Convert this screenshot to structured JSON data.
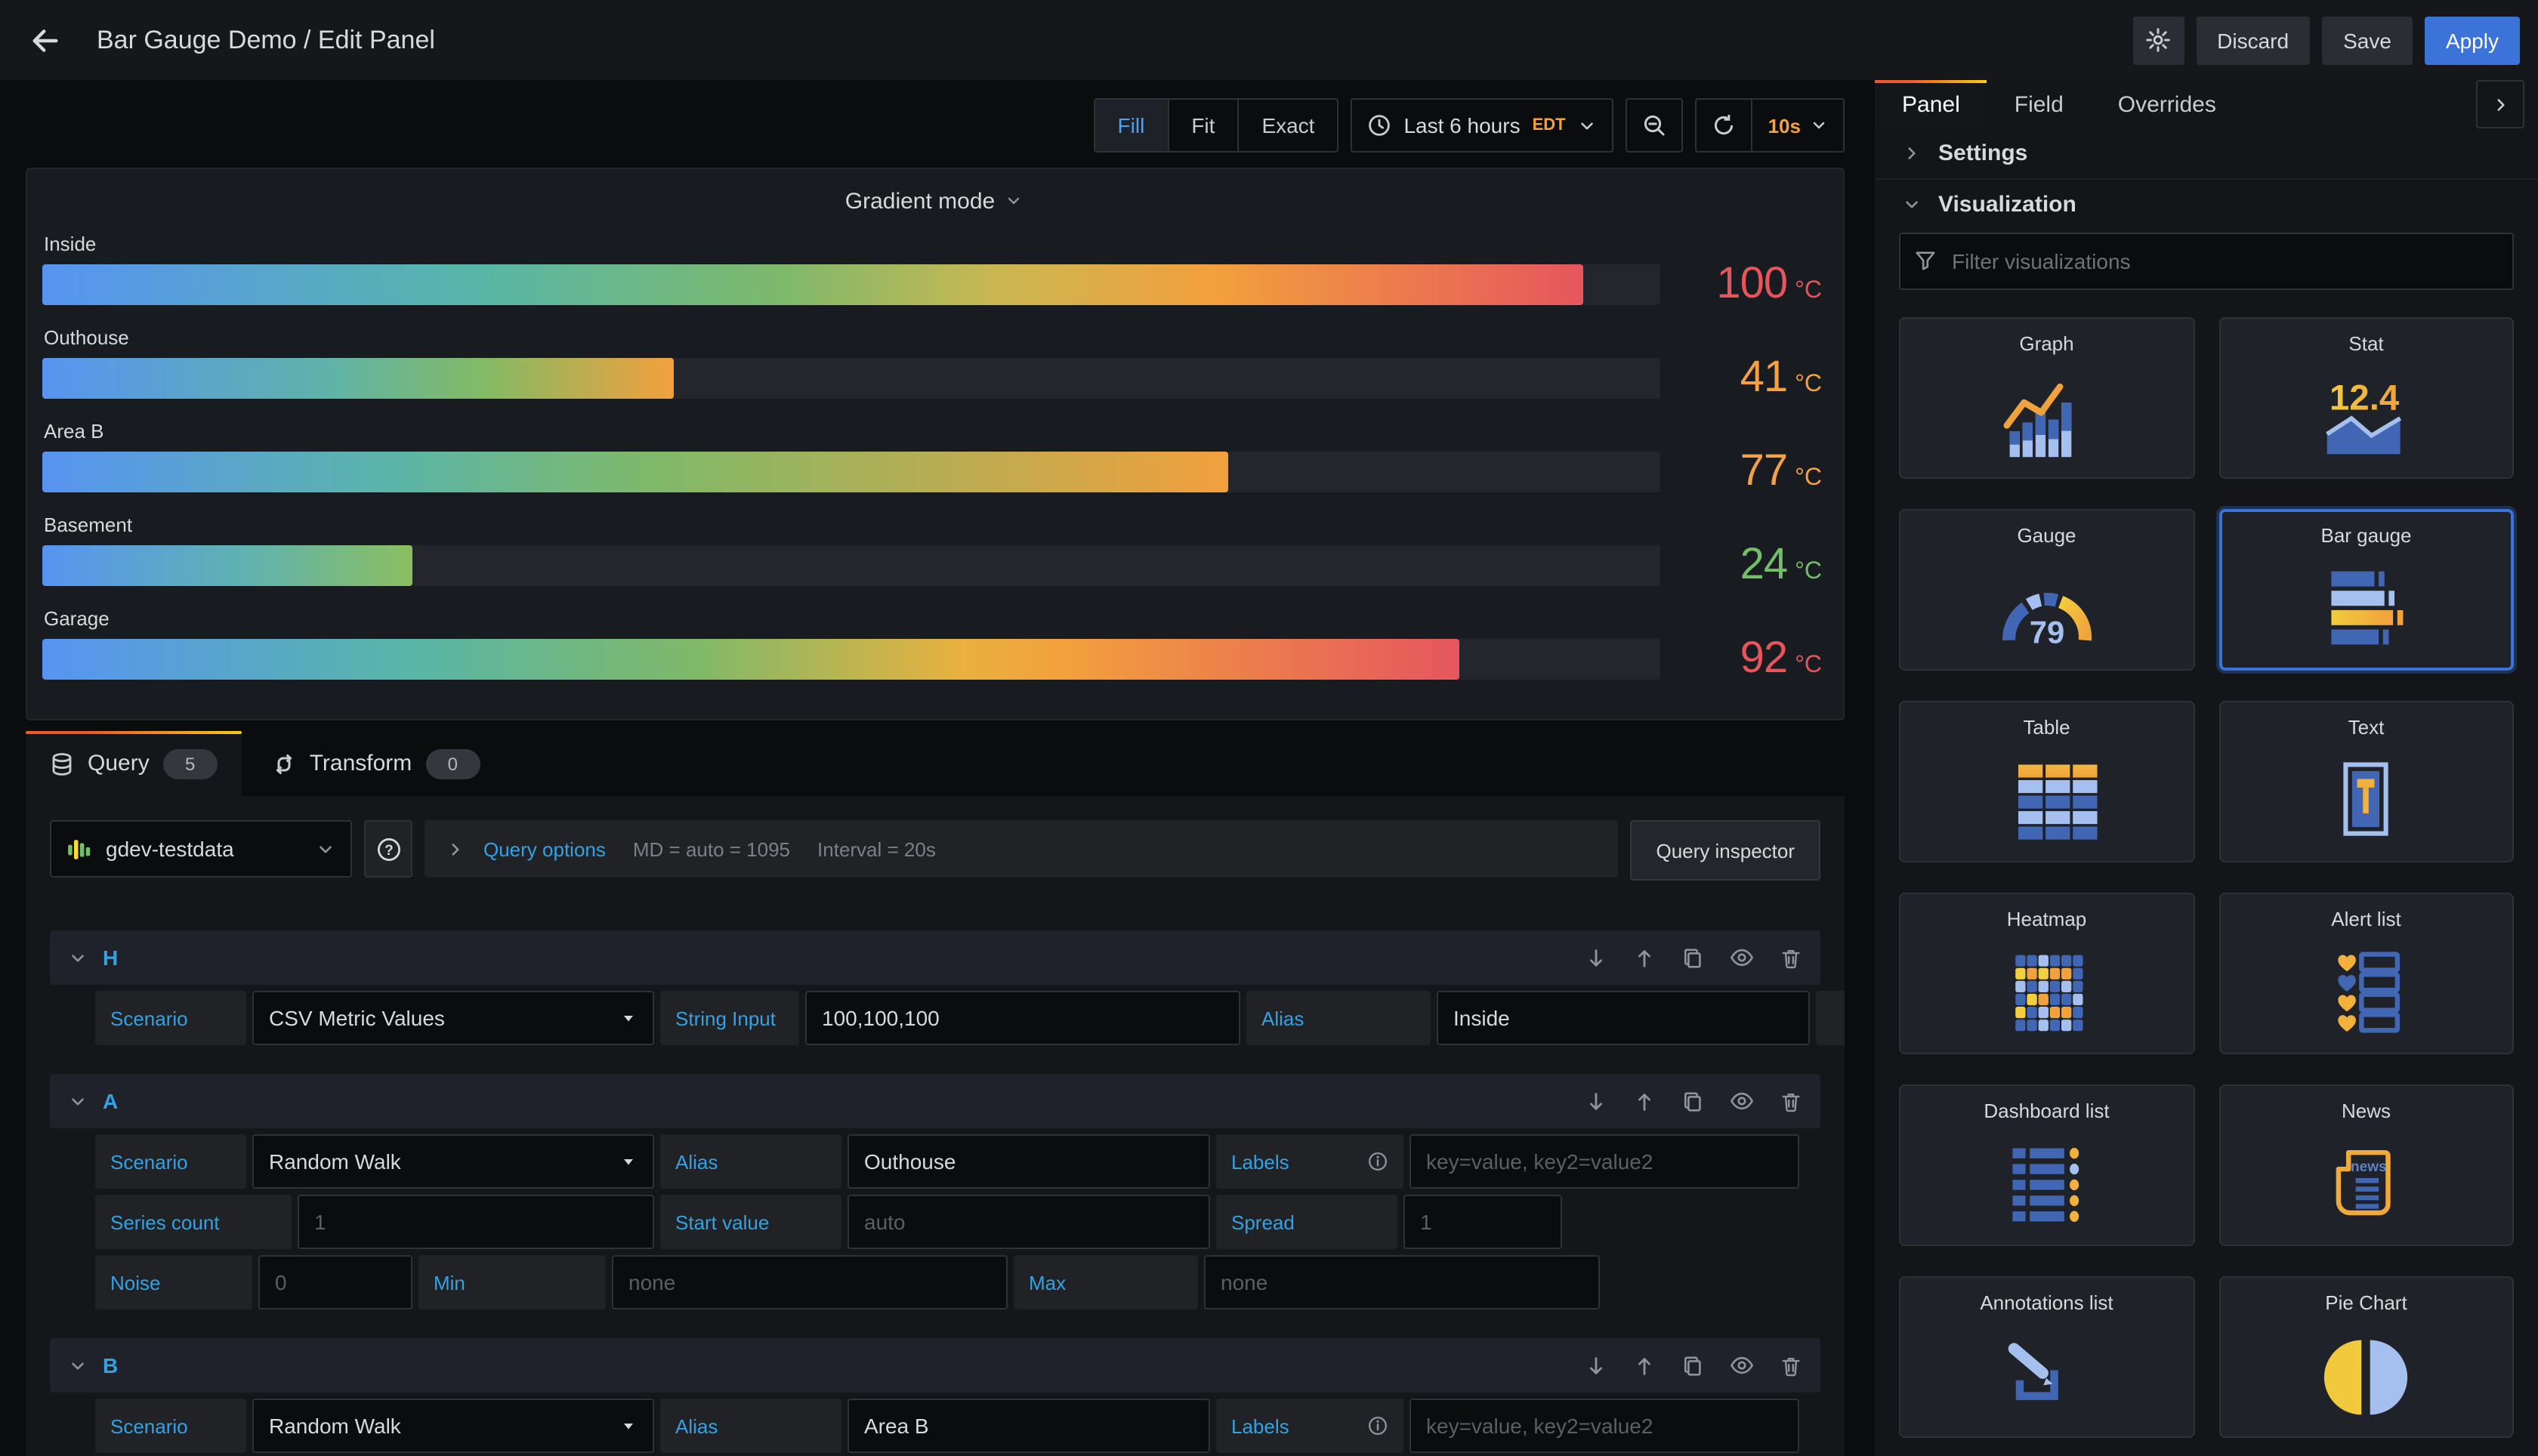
{
  "header": {
    "title": "Bar Gauge Demo / Edit Panel",
    "discard_label": "Discard",
    "save_label": "Save",
    "apply_label": "Apply"
  },
  "toolbar": {
    "view_modes": [
      "Fill",
      "Fit",
      "Exact"
    ],
    "active_view_mode": "Fill",
    "time_range": "Last 6 hours",
    "timezone": "EDT",
    "refresh_interval": "10s"
  },
  "panel": {
    "title": "Gradient mode",
    "gauges": [
      {
        "label": "Inside",
        "value": "100",
        "unit": "°C",
        "pct": 95.2,
        "color": "#e6545c",
        "gradient": "linear-gradient(90deg,#5794f2 0%,#58b6a8 28%,#7eb96b 48%,#cbb752 62%,#f2a03d 76%,#e6565e 100%)"
      },
      {
        "label": "Outhouse",
        "value": "41",
        "unit": "°C",
        "pct": 39.0,
        "color": "#f5a142",
        "gradient": "linear-gradient(90deg,#5794f2 0%,#5fb3a9 45%,#83ba65 70%,#f2a03d 100%)"
      },
      {
        "label": "Area B",
        "value": "77",
        "unit": "°C",
        "pct": 73.3,
        "color": "#f5a142",
        "gradient": "linear-gradient(90deg,#5794f2 0%,#5cb5a7 30%,#80b968 52%,#f2a03d 100%)"
      },
      {
        "label": "Basement",
        "value": "24",
        "unit": "°C",
        "pct": 22.9,
        "color": "#73bf69",
        "gradient": "linear-gradient(90deg,#5794f2 0%,#5fb3b0 55%,#8cbe60 100%)"
      },
      {
        "label": "Garage",
        "value": "92",
        "unit": "°C",
        "pct": 87.6,
        "color": "#e6545c",
        "gradient": "linear-gradient(90deg,#5794f2 0%,#59b6a7 26%,#7fb969 46%,#e9b13f 65%,#f2a03d 72%,#e6565e 100%)"
      }
    ]
  },
  "query_editor": {
    "tabs": [
      {
        "label": "Query",
        "count": "5"
      },
      {
        "label": "Transform",
        "count": "0"
      }
    ],
    "active_tab": "Query",
    "datasource": "gdev-testdata",
    "query_options_label": "Query options",
    "md_text": "MD = auto = 1095",
    "interval_text": "Interval = 20s",
    "inspector_label": "Query inspector",
    "queries": [
      {
        "ref": "H",
        "rows": [
          [
            {
              "label": "Scenario",
              "control": "select",
              "value": "CSV Metric Values"
            },
            {
              "label": "String Input",
              "control": "input",
              "value": "100,100,100"
            },
            {
              "label": "Alias",
              "control": "input",
              "value": "Inside"
            },
            {
              "control": "stub"
            }
          ]
        ]
      },
      {
        "ref": "A",
        "rows": [
          [
            {
              "label": "Scenario",
              "control": "select",
              "value": "Random Walk"
            },
            {
              "label": "Alias",
              "control": "input",
              "value": "Outhouse"
            },
            {
              "label": "Labels",
              "info": true,
              "control": "input",
              "placeholder": "key=value, key2=value2"
            }
          ],
          [
            {
              "label": "Series count",
              "control": "input",
              "placeholder": "1"
            },
            {
              "label": "Start value",
              "control": "input",
              "placeholder": "auto"
            },
            {
              "label": "Spread",
              "control": "input",
              "placeholder": "1"
            }
          ],
          [
            {
              "label": "Noise",
              "control": "input",
              "placeholder": "0"
            },
            {
              "label": "Min",
              "control": "input",
              "placeholder": "none"
            },
            {
              "label": "Max",
              "control": "input",
              "placeholder": "none"
            }
          ]
        ]
      },
      {
        "ref": "B",
        "rows": [
          [
            {
              "label": "Scenario",
              "control": "select",
              "value": "Random Walk"
            },
            {
              "label": "Alias",
              "control": "input",
              "value": "Area B"
            },
            {
              "label": "Labels",
              "info": true,
              "control": "input",
              "placeholder": "key=value, key2=value2"
            }
          ]
        ]
      }
    ]
  },
  "sidebar": {
    "tabs": [
      "Panel",
      "Field",
      "Overrides"
    ],
    "active_tab": "Panel",
    "settings_label": "Settings",
    "visualization_label": "Visualization",
    "filter_placeholder": "Filter visualizations",
    "selected_visualization": "Bar gauge",
    "visualizations": [
      {
        "name": "Graph",
        "icon": "graph"
      },
      {
        "name": "Stat",
        "icon": "stat",
        "value": "12.4"
      },
      {
        "name": "Gauge",
        "icon": "gauge",
        "value": "79"
      },
      {
        "name": "Bar gauge",
        "icon": "bar-gauge"
      },
      {
        "name": "Table",
        "icon": "table"
      },
      {
        "name": "Text",
        "icon": "text"
      },
      {
        "name": "Heatmap",
        "icon": "heatmap"
      },
      {
        "name": "Alert list",
        "icon": "alert-list"
      },
      {
        "name": "Dashboard list",
        "icon": "dashboard-list"
      },
      {
        "name": "News",
        "icon": "news",
        "label": "news"
      },
      {
        "name": "Annotations list",
        "icon": "annotations-list"
      },
      {
        "name": "Pie Chart",
        "icon": "pie-chart"
      }
    ]
  }
}
